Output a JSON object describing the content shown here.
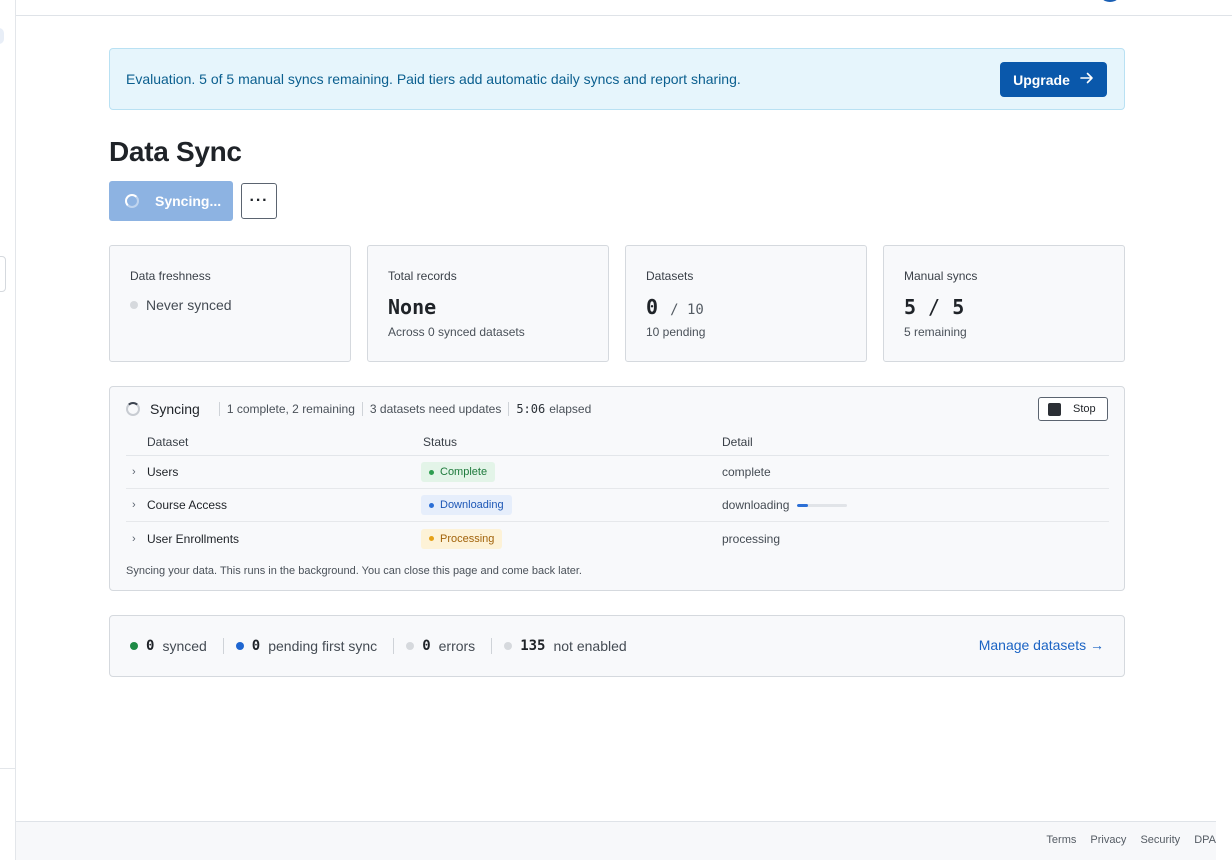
{
  "banner": {
    "text": "Evaluation. 5 of 5 manual syncs remaining. Paid tiers add automatic daily syncs and report sharing.",
    "upgrade_label": "Upgrade",
    "upgrade_icon": "arrow-right-icon"
  },
  "page": {
    "title": "Data Sync"
  },
  "actions": {
    "sync_label": "Syncing...",
    "more_label": "···"
  },
  "cards": {
    "freshness": {
      "label": "Data freshness",
      "status": "Never synced"
    },
    "records": {
      "label": "Total records",
      "value": "None",
      "note": "Across 0 synced datasets"
    },
    "datasets": {
      "label": "Datasets",
      "value": "0",
      "total": "/ 10",
      "note": "10 pending"
    },
    "manual": {
      "label": "Manual syncs",
      "value": "5",
      "sep": "/",
      "total": "5",
      "note": "5 remaining"
    }
  },
  "sync_panel": {
    "title": "Syncing",
    "progress": "1 complete, 2 remaining",
    "needs": "3 datasets need updates",
    "elapsed_time": "5:06",
    "elapsed_label": "elapsed",
    "stop_label": "Stop",
    "columns": [
      "Dataset",
      "Status",
      "Detail"
    ],
    "rows": [
      {
        "dataset": "Users",
        "status": "Complete",
        "detail": "complete"
      },
      {
        "dataset": "Course Access",
        "status": "Downloading",
        "detail": "downloading",
        "progress": 0.22
      },
      {
        "dataset": "User Enrollments",
        "status": "Processing",
        "detail": "processing"
      }
    ],
    "footer": "Syncing your data. This runs in the background. You can close this page and come back later."
  },
  "summary": {
    "synced_count": "0",
    "synced_label": "synced",
    "pending_count": "0",
    "pending_label": "pending first sync",
    "errors_count": "0",
    "errors_label": "errors",
    "disabled_count": "135",
    "disabled_label": "not enabled",
    "manage_label": "Manage datasets →"
  },
  "footer": {
    "links": [
      "Terms",
      "Privacy",
      "Security",
      "DPA"
    ]
  },
  "colors": {
    "accent": "#0a58ab",
    "banner_bg": "#e6f5fc",
    "complete": "#1e7a3c",
    "downloading": "#1d57b6",
    "processing": "#a2630b"
  }
}
